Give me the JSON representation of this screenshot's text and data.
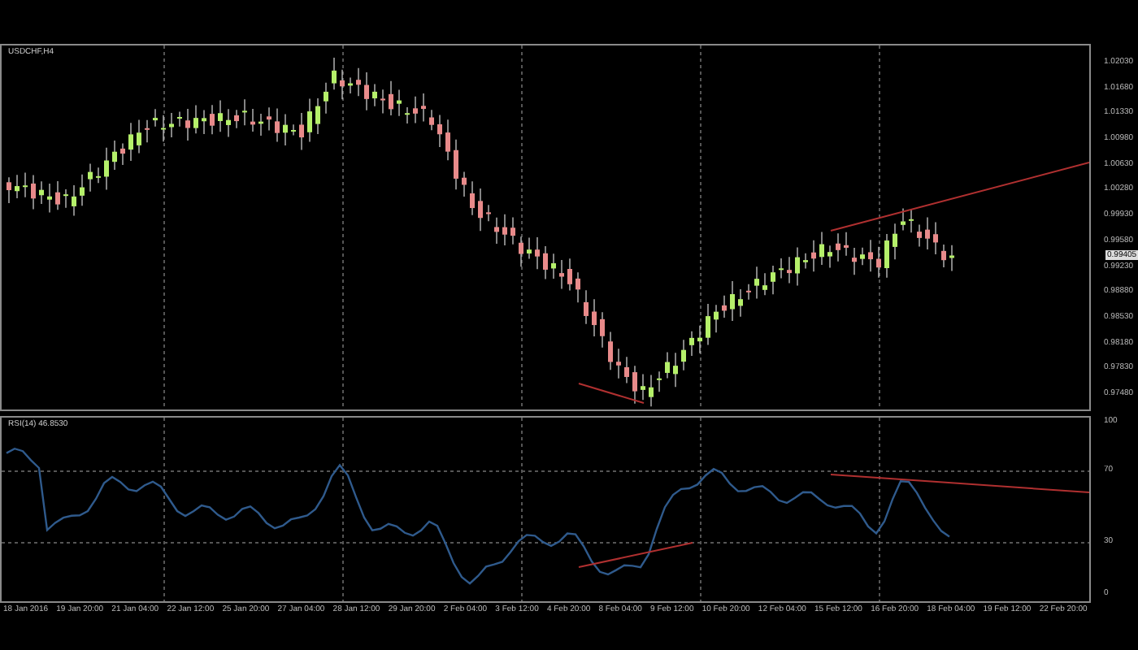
{
  "chart": {
    "title": "USDCHF,H4"
  },
  "indicator": {
    "label": "RSI(14) 46.8530"
  },
  "price_axis": {
    "labels": [
      "1.02030",
      "1.01680",
      "1.01330",
      "1.00980",
      "1.00630",
      "1.00280",
      "0.99930",
      "0.99580",
      "0.99230",
      "0.98880",
      "0.98530",
      "0.98180",
      "0.97830",
      "0.97480"
    ],
    "current_price": "0.99405"
  },
  "rsi_axis": {
    "labels": [
      "100",
      "70",
      "30",
      "0"
    ]
  },
  "time_axis": {
    "labels": [
      "18 Jan 2016",
      "19 Jan 20:00",
      "21 Jan 04:00",
      "22 Jan 12:00",
      "25 Jan 20:00",
      "27 Jan 04:00",
      "28 Jan 12:00",
      "29 Jan 20:00",
      "2 Feb 04:00",
      "3 Feb 12:00",
      "4 Feb 20:00",
      "8 Feb 04:00",
      "9 Feb 12:00",
      "10 Feb 20:00",
      "12 Feb 04:00",
      "15 Feb 12:00",
      "16 Feb 20:00",
      "18 Feb 04:00",
      "19 Feb 12:00",
      "22 Feb 20:00"
    ]
  }
}
